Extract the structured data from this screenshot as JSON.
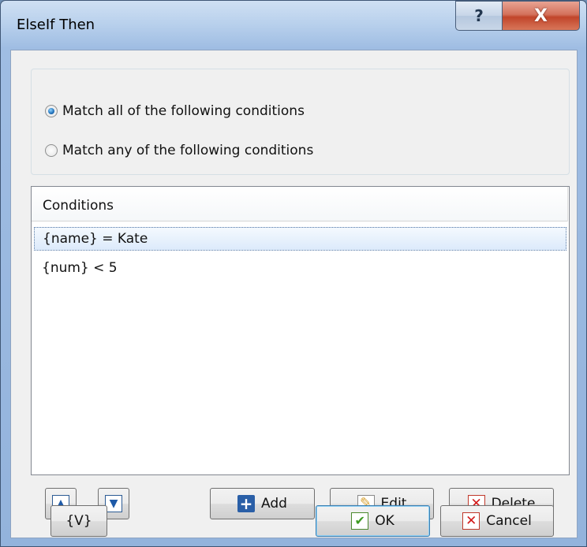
{
  "window": {
    "title": "ElseIf Then",
    "help_label": "?",
    "close_label": "X"
  },
  "match_mode": {
    "options": [
      {
        "label": "Match all of the following conditions",
        "checked": true
      },
      {
        "label": "Match any of the following conditions",
        "checked": false
      }
    ]
  },
  "conditions": {
    "header": "Conditions",
    "rows": [
      {
        "text": "{name} = Kate",
        "selected": true
      },
      {
        "text": "{num} < 5",
        "selected": false
      }
    ]
  },
  "toolbar": {
    "move_up_icon": "arrow-up-icon",
    "move_down_icon": "arrow-down-icon",
    "add_label": "Add",
    "edit_label": "Edit",
    "delete_label": "Delete"
  },
  "footer": {
    "variables_label": "{V}",
    "ok_label": "OK",
    "cancel_label": "Cancel"
  },
  "colors": {
    "accent": "#1f6fb8",
    "close_red": "#c1452a",
    "selection": "#dceafb"
  }
}
